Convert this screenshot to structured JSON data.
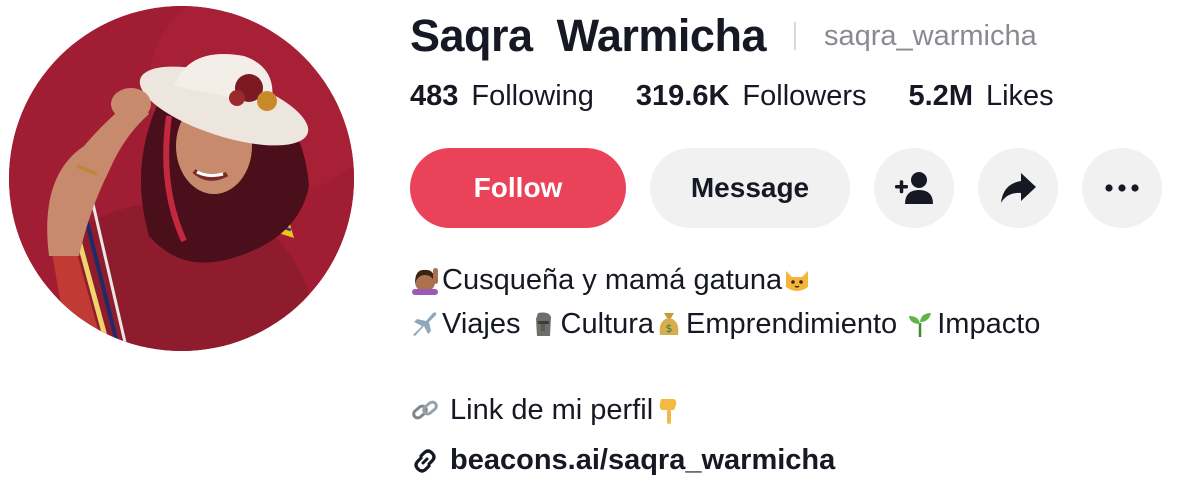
{
  "profile": {
    "display_name": "Saqra  Warmicha",
    "username": "saqra_warmicha"
  },
  "stats": [
    {
      "value": "483",
      "label": "Following"
    },
    {
      "value": "319.6K",
      "label": "Followers"
    },
    {
      "value": "5.2M",
      "label": "Likes"
    }
  ],
  "actions": {
    "follow_label": "Follow",
    "message_label": "Message",
    "add_friend_icon": "person-plus-icon",
    "share_icon": "share-arrow-icon",
    "more_icon": "ellipsis-icon"
  },
  "bio": {
    "line1": "Cusqueña y mamá gatuna",
    "line2_a": "Viajes ",
    "line2_b": "Cultura",
    "line2_c": "Emprendimiento ",
    "line2_d": "Impacto",
    "line3": " Link de mi perfil"
  },
  "link": {
    "url_text": "beacons.ai/saqra_warmicha"
  },
  "colors": {
    "follow_button": "#ea4359",
    "secondary_button": "#f1f1f2",
    "text_primary": "#161823",
    "text_secondary": "#8a8b91"
  }
}
